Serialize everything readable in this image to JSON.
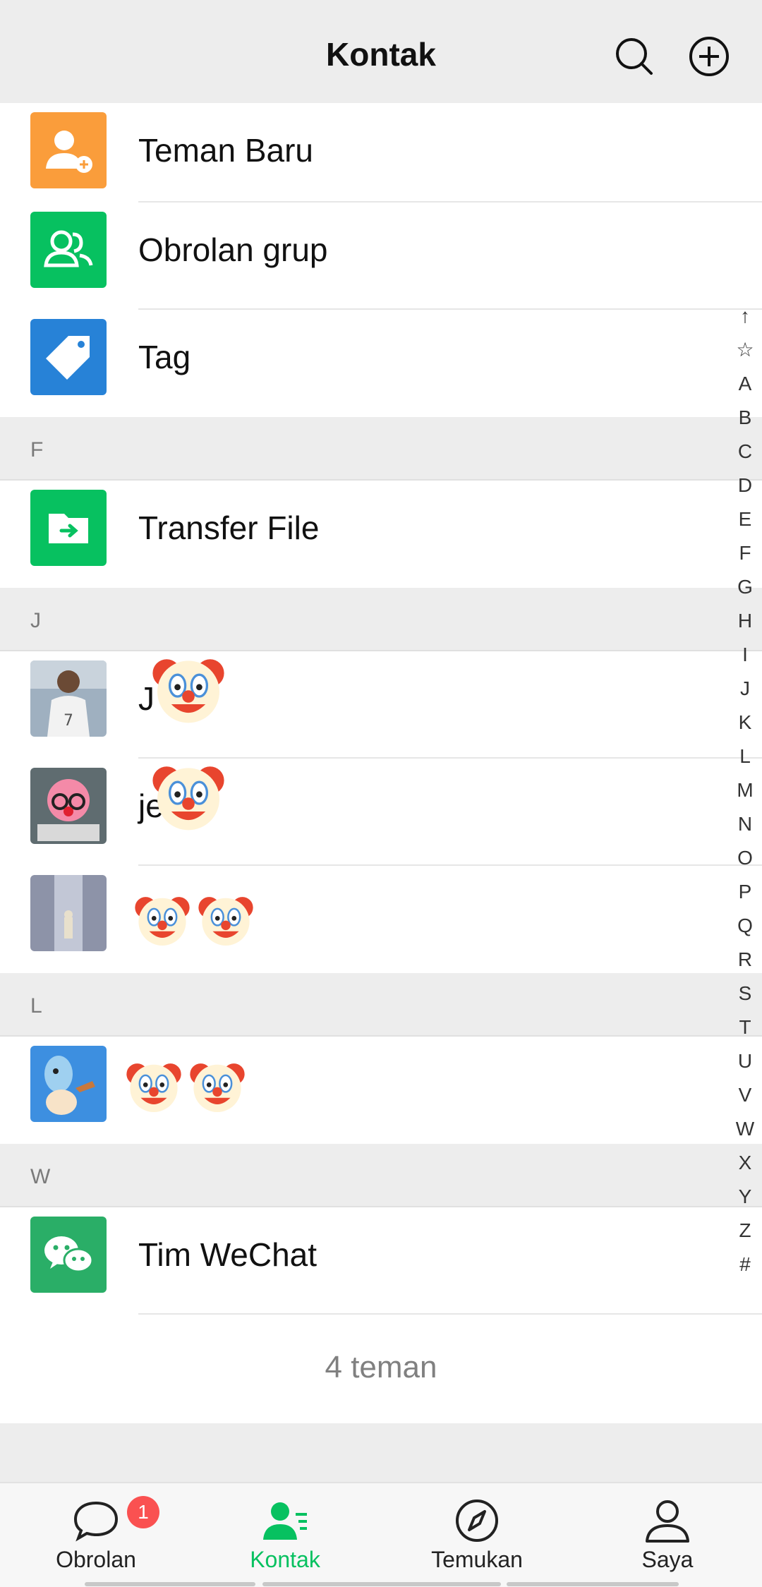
{
  "header": {
    "title": "Kontak"
  },
  "fixed_rows": [
    {
      "label": "Teman Baru",
      "icon": "add-friend-icon",
      "color": "#fa9d3b"
    },
    {
      "label": "Obrolan grup",
      "icon": "group-icon",
      "color": "#07c160"
    },
    {
      "label": "Tag",
      "icon": "tag-icon",
      "color": "#2782d7"
    }
  ],
  "sections": [
    {
      "letter": "F",
      "contacts": [
        {
          "name": "Transfer File"
        }
      ]
    },
    {
      "letter": "J",
      "contacts": [
        {
          "name": "J"
        },
        {
          "name": "je"
        },
        {
          "name": ""
        }
      ]
    },
    {
      "letter": "L",
      "contacts": [
        {
          "name": ""
        }
      ]
    },
    {
      "letter": "W",
      "contacts": [
        {
          "name": "Tim WeChat"
        }
      ]
    }
  ],
  "friend_count": "4 teman",
  "index_letters": [
    "↑",
    "☆",
    "A",
    "B",
    "C",
    "D",
    "E",
    "F",
    "G",
    "H",
    "I",
    "J",
    "K",
    "L",
    "M",
    "N",
    "O",
    "P",
    "Q",
    "R",
    "S",
    "T",
    "U",
    "V",
    "W",
    "X",
    "Y",
    "Z",
    "#"
  ],
  "tabs": [
    {
      "label": "Obrolan",
      "badge": "1"
    },
    {
      "label": "Kontak"
    },
    {
      "label": "Temukan"
    },
    {
      "label": "Saya"
    }
  ],
  "colors": {
    "accent": "#07c160",
    "badge": "#fa5151"
  }
}
